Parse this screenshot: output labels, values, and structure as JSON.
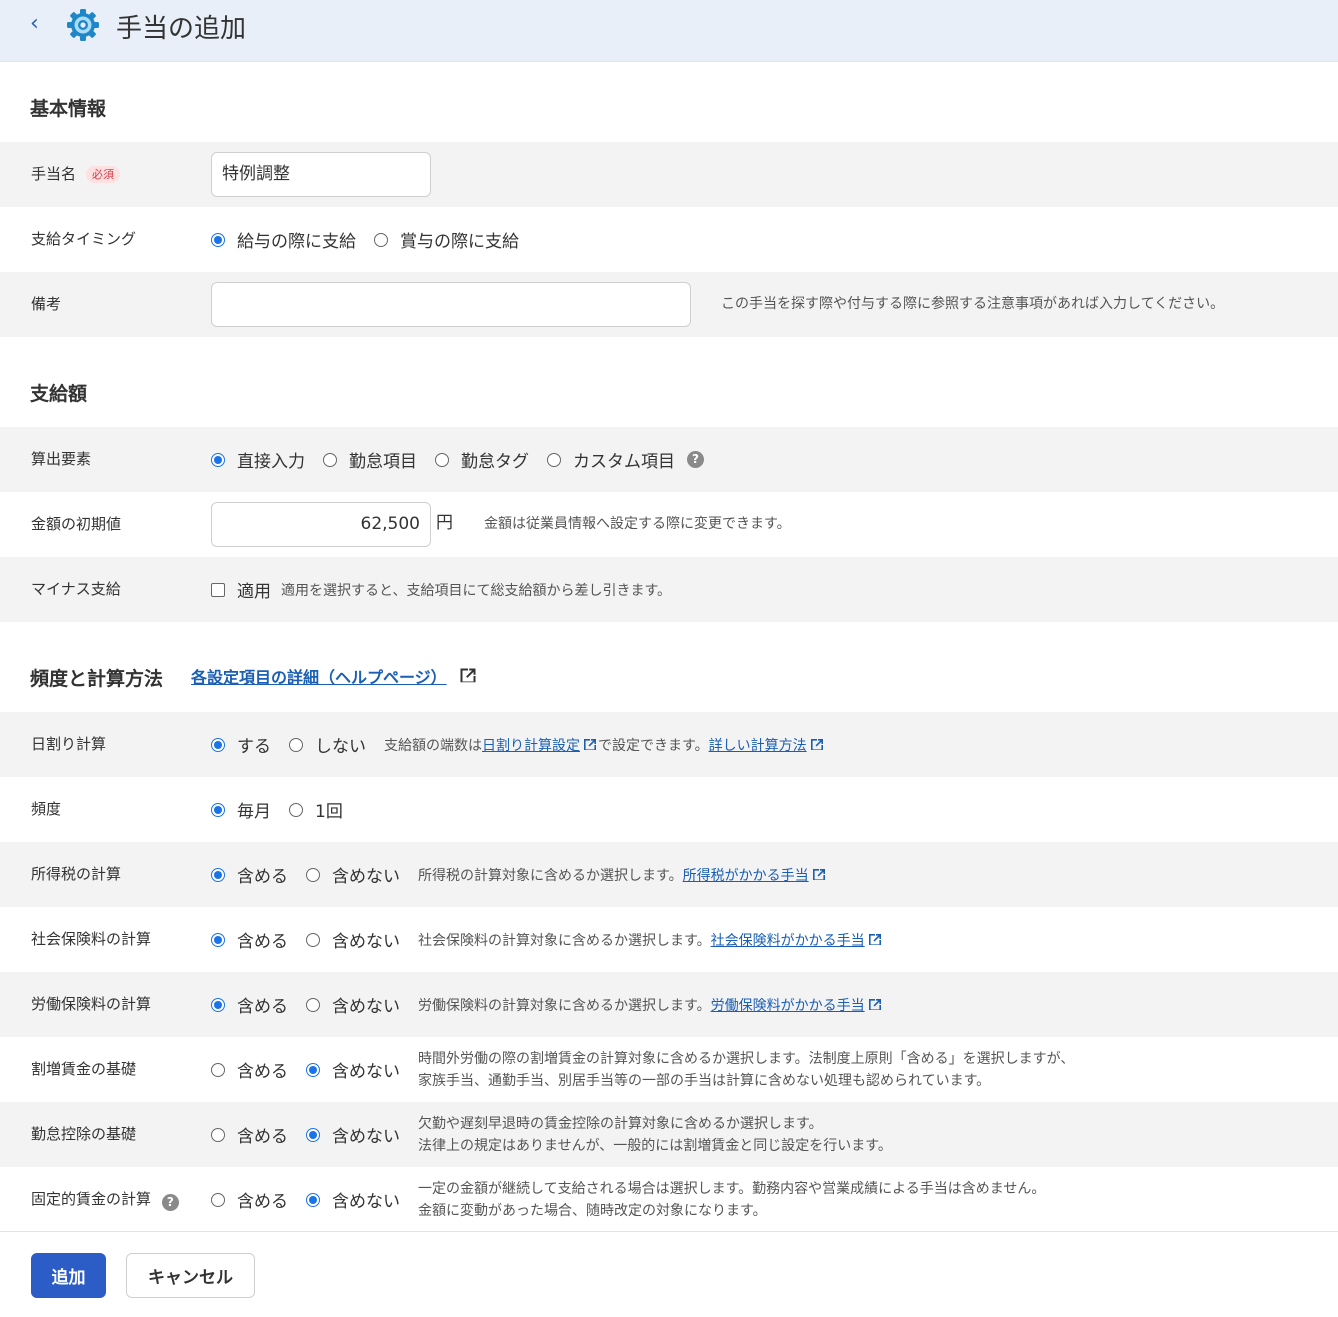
{
  "header": {
    "back_label": "‹",
    "title": "手当の追加"
  },
  "basic": {
    "section_title": "基本情報",
    "name_label": "手当名",
    "required_badge": "必須",
    "name_value": "特例調整",
    "timing_label": "支給タイミング",
    "timing_options": [
      "給与の際に支給",
      "賞与の際に支給"
    ],
    "remarks_label": "備考",
    "remarks_value": "",
    "remarks_note": "この手当を探す際や付与する際に参照する注意事項があれば入力してください。"
  },
  "amount": {
    "section_title": "支給額",
    "calc_label": "算出要素",
    "calc_options": [
      "直接入力",
      "勤怠項目",
      "勤怠タグ",
      "カスタム項目"
    ],
    "help_mark": "?",
    "initial_label": "金額の初期値",
    "initial_value": "62,500",
    "unit": "円",
    "initial_note": "金額は従業員情報へ設定する際に変更できます。",
    "minus_label": "マイナス支給",
    "minus_option": "適用",
    "minus_note": "適用を選択すると、支給項目にて総支給額から差し引きます。"
  },
  "freq": {
    "section_title": "頻度と計算方法",
    "help_link": "各設定項目の詳細（ヘルプページ）",
    "daily_label": "日割り計算",
    "daily_options": [
      "する",
      "しない"
    ],
    "daily_note_a": "支給額の端数は",
    "daily_link1": "日割り計算設定",
    "daily_note_b": "で設定できます。",
    "daily_link2": "詳しい計算方法",
    "frequency_label": "頻度",
    "frequency_options": [
      "毎月",
      "1回"
    ],
    "include": "含める",
    "exclude": "含めない",
    "income_tax_label": "所得税の計算",
    "income_tax_note": "所得税の計算対象に含めるか選択します。",
    "income_tax_link": "所得税がかかる手当",
    "social_label": "社会保険料の計算",
    "social_note": "社会保険料の計算対象に含めるか選択します。",
    "social_link": "社会保険料がかかる手当",
    "labor_label": "労働保険料の計算",
    "labor_note": "労働保険料の計算対象に含めるか選択します。",
    "labor_link": "労働保険料がかかる手当",
    "overtime_label": "割増賃金の基礎",
    "overtime_note1": "時間外労働の際の割増賃金の計算対象に含めるか選択します。法制度上原則「含める」を選択しますが、",
    "overtime_note2": "家族手当、通勤手当、別居手当等の一部の手当は計算に含めない処理も認められています。",
    "deduction_label": "勤怠控除の基礎",
    "deduction_note1": "欠勤や遅刻早退時の賃金控除の計算対象に含めるか選択します。",
    "deduction_note2": "法律上の規定はありませんが、一般的には割増賃金と同じ設定を行います。",
    "fixed_label": "固定的賃金の計算",
    "fixed_note1": "一定の金額が継続して支給される場合は選択します。勤務内容や営業成績による手当は含めません。",
    "fixed_note2": "金額に変動があった場合、随時改定の対象になります。"
  },
  "footer": {
    "add_label": "追加",
    "cancel_label": "キャンセル"
  },
  "colors": {
    "primary": "#2c5cc5",
    "radio": "#1a73e8",
    "header_bg": "#e8eff8",
    "row_bg": "#f4f3f3",
    "link": "#1a5fb4"
  },
  "icons": {
    "header": "gear-icon",
    "back": "chevron-left-icon",
    "external": "external-link-icon"
  }
}
